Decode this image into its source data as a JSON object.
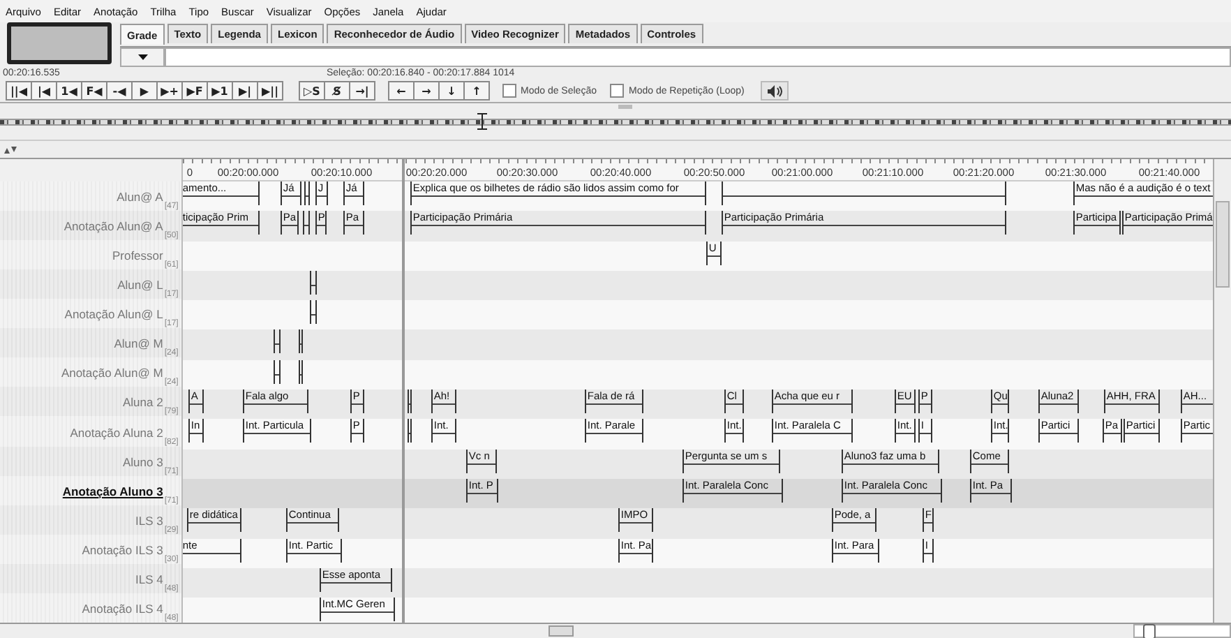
{
  "menu": [
    "Arquivo",
    "Editar",
    "Anotação",
    "Trilha",
    "Tipo",
    "Buscar",
    "Visualizar",
    "Opções",
    "Janela",
    "Ajudar"
  ],
  "tabs": [
    {
      "label": "Grade",
      "selected": true
    },
    {
      "label": "Texto",
      "selected": false
    },
    {
      "label": "Legenda",
      "selected": false
    },
    {
      "label": "Lexicon",
      "selected": false
    },
    {
      "label": "Reconhecedor de Áudio",
      "selected": false
    },
    {
      "label": "Video Recognizer",
      "selected": false
    },
    {
      "label": "Metadados",
      "selected": false
    },
    {
      "label": "Controles",
      "selected": false
    }
  ],
  "zoom": {
    "level": 0.1
  },
  "media_time": "00:20:16.535",
  "selection": "Seleção: 00:20:16.840 - 00:20:17.884  1014",
  "player_buttons": [
    "||◀",
    "|◀",
    "1◀",
    "F◀",
    "-◀",
    "▶",
    "▶+",
    "▶F",
    "▶1",
    "▶|",
    "▶||"
  ],
  "selection_buttons": [
    "▷S",
    "S̸",
    "→|"
  ],
  "arrow_buttons": [
    "←",
    "→",
    "↓",
    "↑"
  ],
  "options": [
    {
      "label": "Modo de Seleção",
      "checked": false
    },
    {
      "label": "Modo de Repetição (Loop)",
      "checked": false
    }
  ],
  "ruler": [
    "0",
    "00:20:00.000",
    "00:20:10.000",
    "00:20:20.000",
    "00:20:30.000",
    "00:20:40.000",
    "00:20:50.000",
    "00:21:00.000",
    "00:21:10.000",
    "00:21:20.000",
    "00:21:30.000",
    "00:21:40.000"
  ],
  "tiers": [
    {
      "name": "Alun@ A",
      "count": "[47]",
      "selected": false,
      "annotations": [
        "amento...",
        "Já",
        "J",
        "Já",
        "Explica que os bilhetes de rádio são lidos assim como for",
        "Mas não é a audição é o text"
      ]
    },
    {
      "name": "Anotação Alun@ A",
      "count": "[50]",
      "selected": false,
      "annotations": [
        "ticipação Prim",
        "Pa",
        "P",
        "Pa",
        "Participação Primária",
        "Participação Primária",
        "Participa",
        "Participação Primá"
      ]
    },
    {
      "name": "Professor",
      "count": "[61]",
      "selected": false,
      "annotations": [
        "U"
      ]
    },
    {
      "name": "Alun@ L",
      "count": "[17]",
      "selected": false
    },
    {
      "name": "Anotação Alun@ L",
      "count": "[17]",
      "selected": false
    },
    {
      "name": "Alun@ M",
      "count": "[24]",
      "selected": false
    },
    {
      "name": "Anotação Alun@ M",
      "count": "[24]",
      "selected": false
    },
    {
      "name": "Aluna 2",
      "count": "[79]",
      "selected": false,
      "annotations": [
        "A",
        "Fala algo",
        "P",
        "Ah!",
        "Fala de rá",
        "Cl",
        "Acha que eu r",
        "EU",
        "P",
        "Qu",
        "Aluna2",
        "AHH, FRA",
        "AH..."
      ]
    },
    {
      "name": "Anotação Aluna 2",
      "count": "[82]",
      "selected": false,
      "annotations": [
        "In",
        "Int. Particula",
        "P",
        "Int.",
        "Int. Parale",
        "Int.",
        "Int. Paralela C",
        "Int.",
        "I",
        "Int.",
        "Partici",
        "Pa",
        "Partici",
        "Partic"
      ]
    },
    {
      "name": "Aluno 3",
      "count": "[71]",
      "selected": false,
      "annotations": [
        "Vc n",
        "Pergunta se um s",
        "Aluno3 faz uma b",
        "Come"
      ]
    },
    {
      "name": "Anotação Aluno 3",
      "count": "[71]",
      "selected": true,
      "annotations": [
        "Int. P",
        "Int. Paralela Conc",
        "Int. Paralela Conc",
        "Int. Pa"
      ]
    },
    {
      "name": "ILS 3",
      "count": "[29]",
      "selected": false,
      "annotations": [
        "re didática",
        "Continua",
        "IMPO",
        "Pode, a",
        "F"
      ]
    },
    {
      "name": "Anotação ILS 3",
      "count": "[30]",
      "selected": false,
      "annotations": [
        "nte",
        "Int. Partic",
        "Int. Pa",
        "Int. Para",
        "I"
      ]
    },
    {
      "name": "ILS 4",
      "count": "[48]",
      "selected": false,
      "annotations": [
        "Esse aponta"
      ]
    },
    {
      "name": "Anotação ILS 4",
      "count": "[48]",
      "selected": false,
      "annotations": [
        "Int.MC Geren"
      ]
    }
  ]
}
